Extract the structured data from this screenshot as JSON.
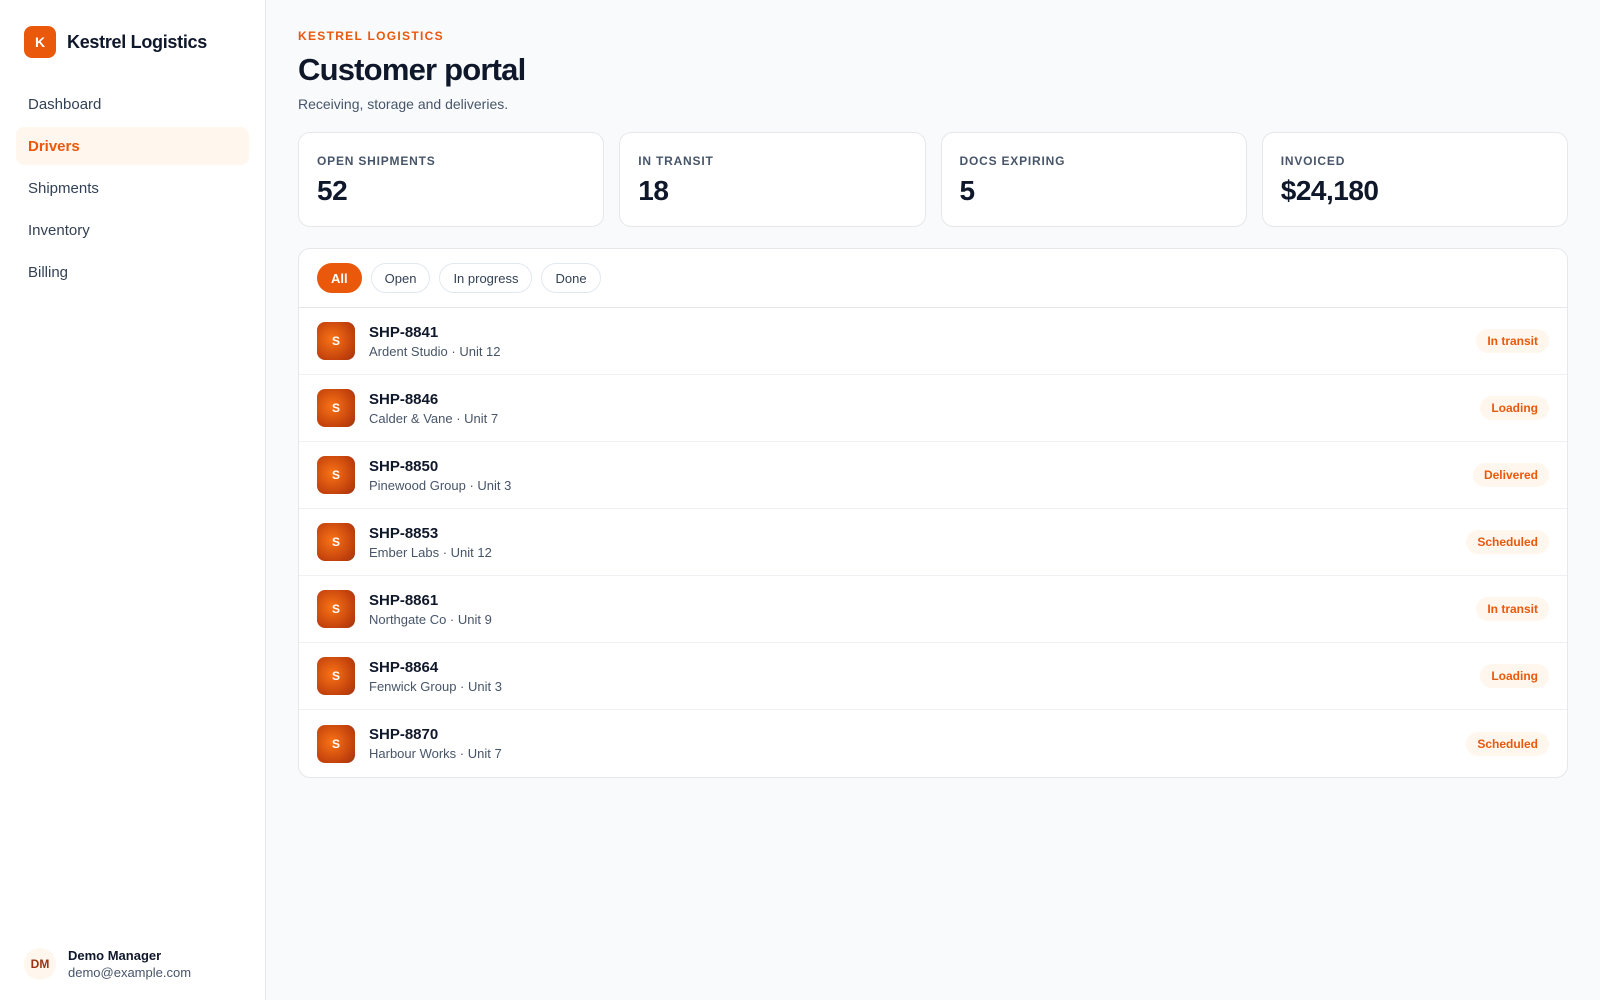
{
  "brand": {
    "logo_letter": "K",
    "name": "Kestrel Logistics",
    "accent": "#ea580c"
  },
  "sidebar": {
    "items": [
      {
        "label": "Dashboard",
        "active": false
      },
      {
        "label": "Drivers",
        "active": true
      },
      {
        "label": "Shipments",
        "active": false
      },
      {
        "label": "Inventory",
        "active": false
      },
      {
        "label": "Billing",
        "active": false
      }
    ]
  },
  "user": {
    "initials": "DM",
    "name": "Demo Manager",
    "email": "demo@example.com"
  },
  "header": {
    "eyebrow": "KESTREL LOGISTICS",
    "title": "Customer portal",
    "subtitle": "Receiving, storage and deliveries."
  },
  "stats": [
    {
      "label": "OPEN SHIPMENTS",
      "value": "52"
    },
    {
      "label": "IN TRANSIT",
      "value": "18"
    },
    {
      "label": "DOCS EXPIRING",
      "value": "5"
    },
    {
      "label": "INVOICED",
      "value": "$24,180"
    }
  ],
  "filters": [
    {
      "label": "All",
      "active": true
    },
    {
      "label": "Open",
      "active": false
    },
    {
      "label": "In progress",
      "active": false
    },
    {
      "label": "Done",
      "active": false
    }
  ],
  "shipments": [
    {
      "avatar": "S",
      "id": "SHP-8841",
      "detail": "Ardent Studio · Unit 12",
      "status": "In transit"
    },
    {
      "avatar": "S",
      "id": "SHP-8846",
      "detail": "Calder & Vane · Unit 7",
      "status": "Loading"
    },
    {
      "avatar": "S",
      "id": "SHP-8850",
      "detail": "Pinewood Group · Unit 3",
      "status": "Delivered"
    },
    {
      "avatar": "S",
      "id": "SHP-8853",
      "detail": "Ember Labs · Unit 12",
      "status": "Scheduled"
    },
    {
      "avatar": "S",
      "id": "SHP-8861",
      "detail": "Northgate Co · Unit 9",
      "status": "In transit"
    },
    {
      "avatar": "S",
      "id": "SHP-8864",
      "detail": "Fenwick Group · Unit 3",
      "status": "Loading"
    },
    {
      "avatar": "S",
      "id": "SHP-8870",
      "detail": "Harbour Works · Unit 7",
      "status": "Scheduled"
    }
  ]
}
